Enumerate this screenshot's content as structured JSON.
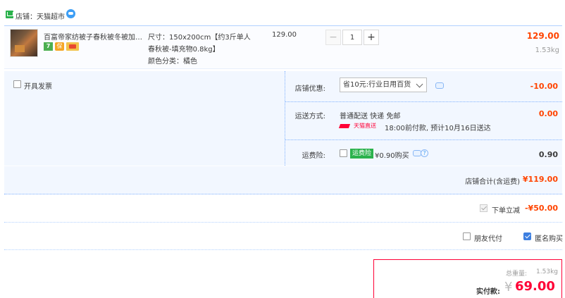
{
  "shop": {
    "label": "店铺：天猫超市",
    "icon": "shop-icon",
    "contact_icon": "wangwang-chat-icon"
  },
  "item": {
    "title": "百富帝家纺被子春秋被冬被加厚...",
    "badges": [
      "7",
      "保",
      "卡"
    ],
    "spec_size": "尺寸：150x200cm【约3斤单人",
    "spec_size_cont": "春秋被-填充物0.8kg】",
    "spec_color": "颜色分类：橘色",
    "unit_price": "129.00",
    "quantity": "1",
    "minus": "−",
    "plus": "+",
    "subtotal": "129.00",
    "weight": "1.53kg"
  },
  "options": {
    "invoice_label": "开具发票",
    "coupon_label": "店铺优惠:",
    "coupon_selected": "省10元:行业日用百货",
    "coupon_value": "-10.00",
    "shipping_label": "运送方式:",
    "shipping_method": "普通配送 快递 免邮",
    "shipping_badge": "天猫直送",
    "shipping_time": "18:00前付款, 预计10月16日送达",
    "shipping_value": "0.00",
    "insurance_label": "运费险:",
    "insurance_tag": "运费险",
    "insurance_text": "¥0.90购买",
    "insurance_help": "?",
    "insurance_value": "0.90"
  },
  "total": {
    "label": "店铺合计(含运费)",
    "value": "¥119.00"
  },
  "discount": {
    "label": "下单立减",
    "value": "-¥50.00"
  },
  "extras": {
    "friend_pay": "朋友代付",
    "anonymous": "匿名购买",
    "anonymous_checked": true
  },
  "pay": {
    "weight_label": "总重量:",
    "weight_value": "1.53kg",
    "label": "实付款:",
    "currency": "¥",
    "amount": "69.00"
  },
  "colors": {
    "accent_red": "#ff0036",
    "price_orange": "#ff4400",
    "border_blue": "#80b2ff",
    "panel_bg": "#f2f7ff"
  }
}
